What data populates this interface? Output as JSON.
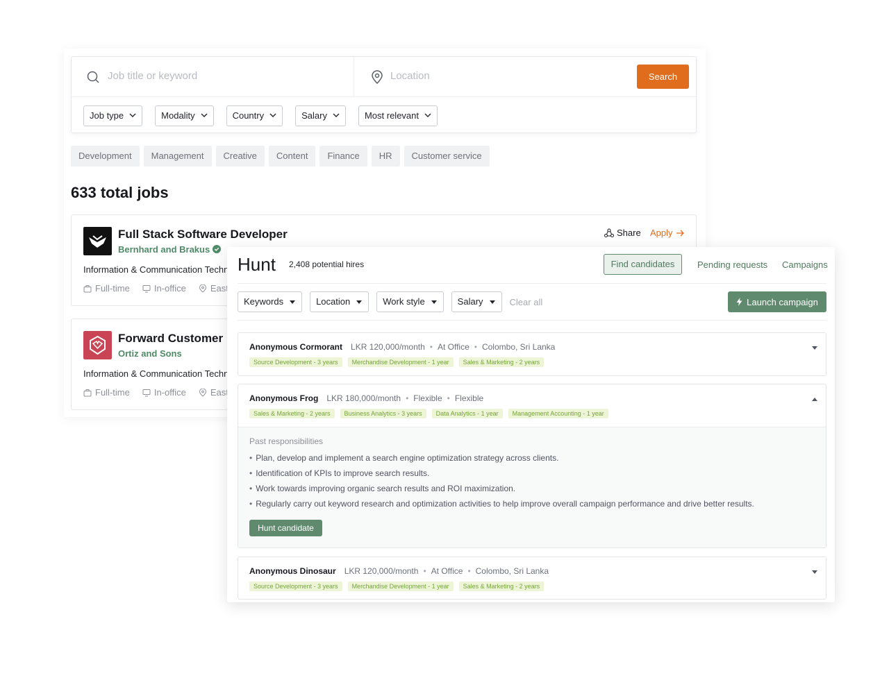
{
  "jobs": {
    "search": {
      "keyword_placeholder": "Job title or keyword",
      "location_placeholder": "Location",
      "search_label": "Search"
    },
    "filters": [
      "Job type",
      "Modality",
      "Country",
      "Salary",
      "Most relevant"
    ],
    "categories": [
      "Development",
      "Management",
      "Creative",
      "Content",
      "Finance",
      "HR",
      "Customer service"
    ],
    "total_label": "633 total jobs",
    "listings": [
      {
        "title": "Full Stack Software Developer",
        "company": "Bernhard and Brakus",
        "industry": "Information & Communication Technol",
        "type": "Full-time",
        "modality": "In-office",
        "location": "East",
        "share_label": "Share",
        "apply_label": "Apply"
      },
      {
        "title": "Forward Customer Me",
        "company": "Ortiz and Sons",
        "industry": "Information & Communication Technol",
        "type": "Full-time",
        "modality": "In-office",
        "location": "East"
      }
    ]
  },
  "hunt": {
    "title": "Hunt",
    "count": "2,408 potential hires",
    "nav": {
      "find": "Find candidates",
      "pending": "Pending requests",
      "campaigns": "Campaigns"
    },
    "filters": [
      "Keywords",
      "Location",
      "Work style",
      "Salary"
    ],
    "clear_all": "Clear all",
    "launch_label": "Launch campaign",
    "colors": {
      "primary_green": "#5f8a6e",
      "accent_orange": "#e06d1e"
    },
    "candidates": [
      {
        "name": "Anonymous Cormorant",
        "salary": "LKR 120,000/month",
        "work": "At Office",
        "place": "Colombo, Sri Lanka",
        "skills": [
          "Source Development - 3 years",
          "Merchandise Development - 1 year",
          "Sales & Marketing - 2 years"
        ]
      },
      {
        "name": "Anonymous Frog",
        "salary": "LKR 180,000/month",
        "work": "Flexible",
        "place": "Flexible",
        "skills": [
          "Sales & Marketing - 2 years",
          "Business Analytics - 3 years",
          "Data Analytics - 1 year",
          "Management Accounting - 1 year"
        ],
        "responsibilities_label": "Past responsibilities",
        "responsibilities": [
          "Plan, develop and implement a search engine optimization strategy across clients.",
          "Identification of KPIs to improve search results.",
          "Work towards improving organic search results and ROI maximization.",
          "Regularly carry out keyword research and optimization activities to help improve overall campaign performance and drive better results."
        ],
        "hunt_label": "Hunt candidate"
      },
      {
        "name": "Anonymous Dinosaur",
        "salary": "LKR 120,000/month",
        "work": "At Office",
        "place": "Colombo, Sri Lanka",
        "skills": [
          "Source Development - 3 years",
          "Merchandise Development - 1 year",
          "Sales & Marketing - 2 years"
        ]
      }
    ]
  }
}
